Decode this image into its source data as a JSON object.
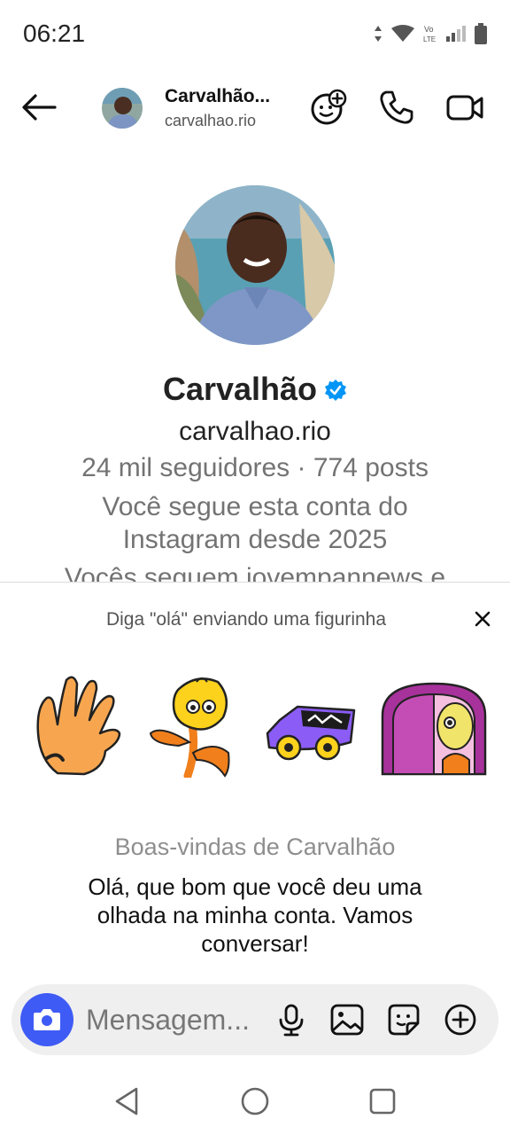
{
  "status_bar": {
    "time": "06:21"
  },
  "header": {
    "name": "Carvalhão...",
    "handle": "carvalhao.rio"
  },
  "profile": {
    "name": "Carvalhão",
    "handle": "carvalhao.rio",
    "stats": "24 mil seguidores · 774 posts",
    "follow_info": "Você segue esta conta do Instagram desde 2025",
    "mutual": "Vocês seguem jovempannews e"
  },
  "sticker_panel": {
    "prompt": "Diga \"olá\" enviando uma figurinha",
    "stickers": [
      "waving-hand-sticker",
      "flower-character-sticker",
      "purple-car-sticker",
      "window-character-sticker"
    ]
  },
  "welcome": {
    "title": "Boas-vindas de Carvalhão",
    "message": "Olá, que bom que você deu uma olhada na minha conta. Vamos conversar!"
  },
  "composer": {
    "placeholder": "Mensagem..."
  },
  "colors": {
    "accent": "#3f5bf5",
    "verified": "#0095f6"
  }
}
